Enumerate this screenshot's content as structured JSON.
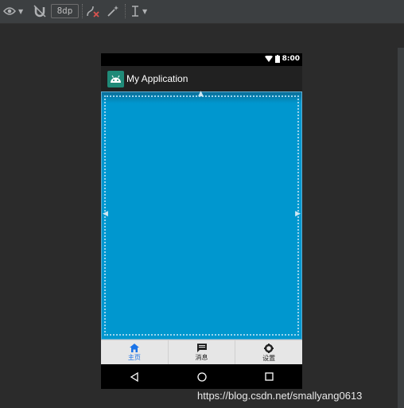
{
  "toolbar": {
    "margin_value": "8dp"
  },
  "device": {
    "status": {
      "time": "8:00"
    },
    "appbar": {
      "title": "My Application"
    },
    "bottom_nav": [
      {
        "label": "主页",
        "icon": "home-icon",
        "active": true
      },
      {
        "label": "消息",
        "icon": "message-icon",
        "active": false
      },
      {
        "label": "设置",
        "icon": "settings-icon",
        "active": false
      }
    ],
    "colors": {
      "content": "#0097cf",
      "active_nav": "#1a73e8",
      "appbar": "#212121"
    }
  },
  "watermark": "https://blog.csdn.net/smallyang0613"
}
